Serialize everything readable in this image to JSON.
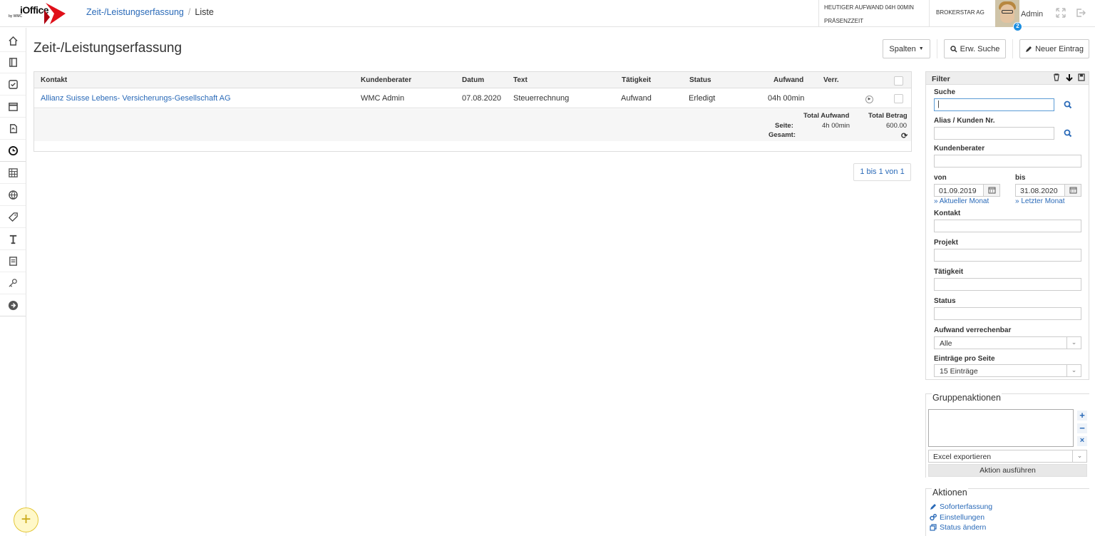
{
  "header": {
    "logo_text": "iOffice",
    "logo_sub": "by WMC",
    "breadcrumb": [
      "Zeit-/Leistungserfassung",
      "Liste"
    ],
    "aufwand_label": "HEUTIGER AUFWAND 04H 00MIN",
    "praesenz_label": "PRÄSENZZEIT",
    "company": "BROKERSTAR AG",
    "user": "Admin",
    "badge": "2"
  },
  "page": {
    "title": "Zeit-/Leistungserfassung",
    "buttons": {
      "spalten": "Spalten",
      "erw_suche": "Erw. Suche",
      "neuer_eintrag": "Neuer Eintrag"
    }
  },
  "table": {
    "columns": [
      "Kontakt",
      "Kundenberater",
      "Datum",
      "Text",
      "Tätigkeit",
      "Status",
      "Aufwand",
      "Verr."
    ],
    "rows": [
      {
        "kontakt": "Allianz Suisse Lebens- Versicherungs-Gesellschaft AG",
        "kundenberater": "WMC Admin",
        "datum": "07.08.2020",
        "text": "Steuerrechnung",
        "taetigkeit": "Aufwand",
        "status": "Erledigt",
        "aufwand": "04h 00min",
        "verr": ""
      }
    ],
    "footer": {
      "total_aufwand_label": "Total Aufwand",
      "total_betrag_label": "Total Betrag",
      "seite_label": "Seite:",
      "gesamt_label": "Gesamt:",
      "seite_aufwand": "4h 00min",
      "seite_betrag": "600.00"
    },
    "pager": "1 bis 1 von 1"
  },
  "filter": {
    "title": "Filter",
    "suche_label": "Suche",
    "suche_value": "|",
    "alias_label": "Alias / Kunden Nr.",
    "kundenberater_label": "Kundenberater",
    "von_label": "von",
    "bis_label": "bis",
    "von_value": "01.09.2019",
    "bis_value": "31.08.2020",
    "aktueller_monat": "» Aktueller Monat",
    "letzter_monat": "» Letzter Monat",
    "kontakt_label": "Kontakt",
    "projekt_label": "Projekt",
    "taetigkeit_label": "Tätigkeit",
    "status_label": "Status",
    "verrechenbar_label": "Aufwand verrechenbar",
    "verrechenbar_value": "Alle",
    "eintraege_label": "Einträge pro Seite",
    "eintraege_value": "15 Einträge"
  },
  "gruppenaktionen": {
    "title": "Gruppenaktionen",
    "select_value": "Excel exportieren",
    "execute": "Aktion ausführen"
  },
  "aktionen": {
    "title": "Aktionen",
    "items": [
      "Soforterfassung",
      "Einstellungen",
      "Status ändern"
    ]
  },
  "nav_icons": [
    "home-icon",
    "contacts-icon",
    "tasks-icon",
    "calendar-icon",
    "documents-icon",
    "time-tracking-icon",
    "reports-icon",
    "globe-icon",
    "tag-icon",
    "text-icon",
    "forms-icon",
    "keys-icon",
    "arrow-right-circle-icon"
  ],
  "colors": {
    "link": "#2a6ab8",
    "brand_red": "#e0101a",
    "fab": "#fff8c9"
  }
}
